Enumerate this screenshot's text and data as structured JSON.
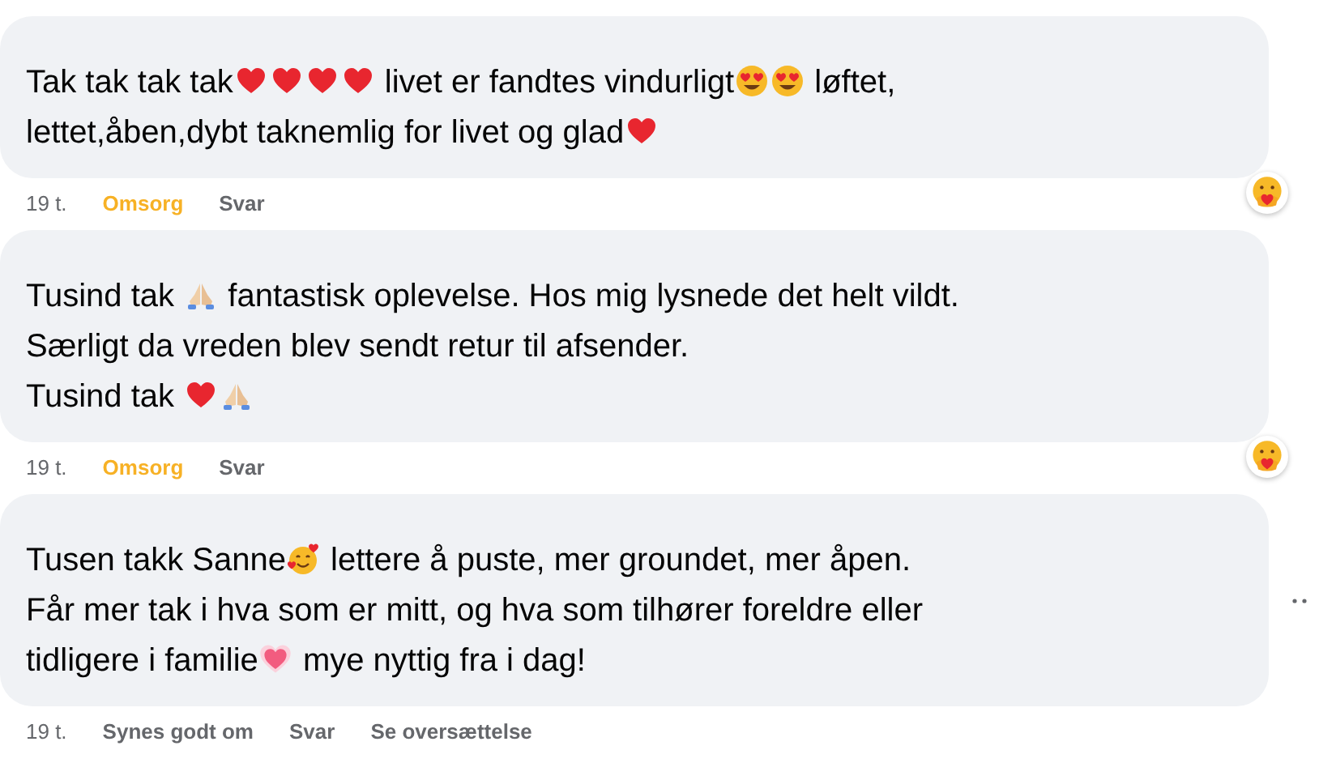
{
  "comments": [
    {
      "lines": [
        [
          {
            "kind": "text",
            "text": "Tak tak tak tak"
          },
          {
            "kind": "heart"
          },
          {
            "kind": "heart"
          },
          {
            "kind": "heart"
          },
          {
            "kind": "heart"
          },
          {
            "kind": "text",
            "text": " livet er fandtes vindurligt"
          },
          {
            "kind": "heart-eyes"
          },
          {
            "kind": "heart-eyes"
          },
          {
            "kind": "text",
            "text": " løftet,"
          }
        ],
        [
          {
            "kind": "text",
            "text": "lettet,åben,dybt taknemlig for livet og glad"
          },
          {
            "kind": "heart"
          }
        ]
      ],
      "time": "19 t.",
      "actions": [
        {
          "label": "Omsorg",
          "reacted": true
        },
        {
          "label": "Svar",
          "reacted": false
        }
      ],
      "care_reaction": true,
      "more": false
    },
    {
      "lines": [
        [
          {
            "kind": "text",
            "text": "Tusind tak "
          },
          {
            "kind": "pray"
          },
          {
            "kind": "text",
            "text": " fantastisk oplevelse. Hos mig lysnede det helt vildt."
          }
        ],
        [
          {
            "kind": "text",
            "text": "Særligt da vreden blev sendt retur til afsender."
          }
        ],
        [
          {
            "kind": "text",
            "text": "Tusind tak "
          },
          {
            "kind": "heart"
          },
          {
            "kind": "pray"
          }
        ]
      ],
      "time": "19 t.",
      "actions": [
        {
          "label": "Omsorg",
          "reacted": true
        },
        {
          "label": "Svar",
          "reacted": false
        }
      ],
      "care_reaction": true,
      "more": false
    },
    {
      "lines": [
        [
          {
            "kind": "text",
            "text": "Tusen takk Sanne"
          },
          {
            "kind": "hearts-face"
          },
          {
            "kind": "text",
            "text": " lettere å puste, mer groundet, mer åpen."
          }
        ],
        [
          {
            "kind": "text",
            "text": "Får mer tak i hva som er mitt, og hva som tilhører foreldre eller"
          }
        ],
        [
          {
            "kind": "text",
            "text": "tidligere i familie"
          },
          {
            "kind": "sparkle-heart"
          },
          {
            "kind": "text",
            "text": " mye nyttig fra i dag!"
          }
        ]
      ],
      "time": "19 t.",
      "actions": [
        {
          "label": "Synes godt om",
          "reacted": false
        },
        {
          "label": "Svar",
          "reacted": false
        },
        {
          "label": "Se oversættelse",
          "reacted": false
        }
      ],
      "care_reaction": false,
      "more": true
    }
  ]
}
